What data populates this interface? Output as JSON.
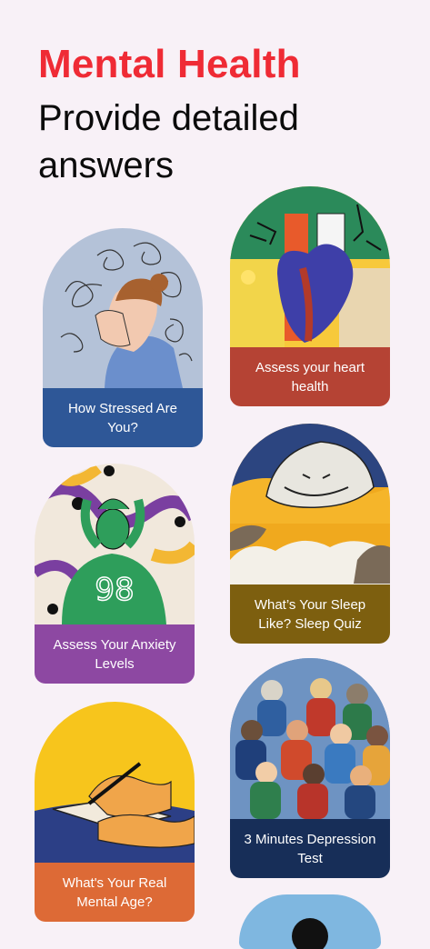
{
  "header": {
    "title": "Mental Health",
    "subtitle_line1": "Provide detailed",
    "subtitle_line2": "answers"
  },
  "cards": [
    {
      "label": "How Stressed Are You?",
      "color": "#2e5797",
      "icon": "stressed-person-illustration"
    },
    {
      "label": "Assess your heart health",
      "color": "#b54334",
      "icon": "heart-illustration"
    },
    {
      "label": "Assess Your Anxiety Levels",
      "color": "#8d48a2",
      "icon": "anxious-person-illustration"
    },
    {
      "label": "What’s Your Sleep Like? Sleep Quiz",
      "color": "#7d5f0f",
      "icon": "sleeping-lion-illustration"
    },
    {
      "label": "What's Your Real Mental Age?",
      "color": "#dd6a36",
      "icon": "writing-hand-illustration"
    },
    {
      "label": "3 Minutes Depression Test",
      "color": "#172e58",
      "icon": "crowd-illustration"
    }
  ],
  "colors": {
    "title": "#ef2b35",
    "background": "#f8f1f7"
  }
}
